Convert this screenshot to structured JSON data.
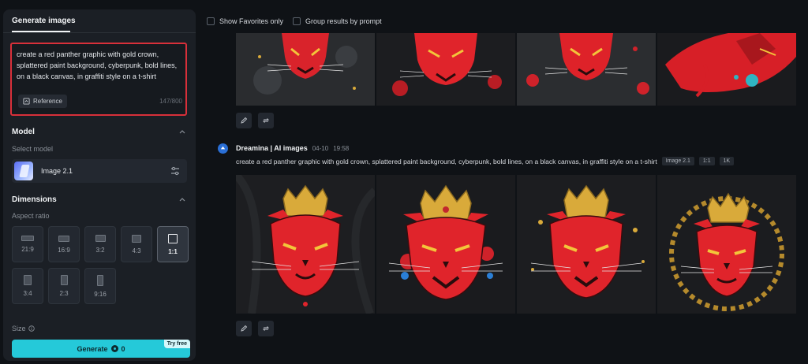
{
  "sidebar": {
    "tab_label": "Generate images",
    "prompt": {
      "text": "create a red panther graphic with gold crown, splattered paint background, cyberpunk, bold lines, on a black canvas, in graffiti style on a t-shirt",
      "reference_label": "Reference",
      "char_count": "147/800"
    },
    "model": {
      "section_title": "Model",
      "select_label": "Select model",
      "selected": "Image 2.1"
    },
    "dimensions": {
      "section_title": "Dimensions",
      "aspect_label": "Aspect ratio",
      "ratios": [
        "21:9",
        "16:9",
        "3:2",
        "4:3",
        "1:1",
        "3:4",
        "2:3",
        "9:16"
      ],
      "selected_ratio": "1:1",
      "size_label": "Size"
    },
    "generate": {
      "label": "Generate",
      "cost": "0",
      "badge": "Try free"
    }
  },
  "topbar": {
    "show_favorites": "Show Favorites only",
    "group_by_prompt": "Group results by prompt"
  },
  "results": {
    "group": {
      "author": "Dreamina | AI images",
      "date": "04-10",
      "time": "19:58",
      "prompt": "create a red panther graphic with gold crown, splattered paint background, cyberpunk, bold lines, on a black canvas, in graffiti style on a t-shirt",
      "tags": [
        "Image 2.1",
        "1:1",
        "1K"
      ]
    }
  },
  "icons": {
    "reference": "image-reference-icon",
    "settings": "sliders-icon",
    "edit": "pencil-icon",
    "regenerate": "refresh-icon",
    "info": "info-icon",
    "avatar": "dreamina-logo-icon"
  },
  "colors": {
    "accent": "#25c9d9",
    "highlight": "#d8303a",
    "panther_red": "#e0242b",
    "crown_gold": "#d9aa3a"
  }
}
